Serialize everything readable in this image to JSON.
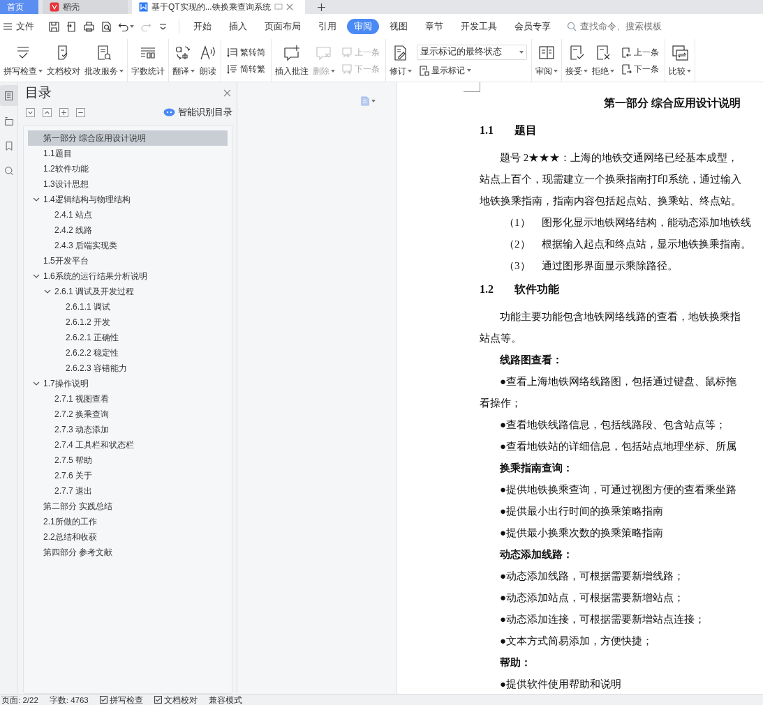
{
  "tabs": [
    {
      "label": "首页",
      "kind": "home",
      "selected": false
    },
    {
      "label": "稻壳",
      "kind": "app",
      "selected": false
    },
    {
      "label": "基于QT实现的...铁换乘查询系统",
      "kind": "doc",
      "selected": true
    }
  ],
  "menu": {
    "file": "文件",
    "quick_access": [
      {
        "disabled": false
      },
      {
        "disabled": false
      },
      {
        "disabled": false
      },
      {
        "disabled": false
      },
      {
        "disabled": false
      },
      {
        "disabled": true
      },
      {
        "disabled": false
      }
    ],
    "tabs": [
      {
        "label": "开始",
        "selected": false
      },
      {
        "label": "插入",
        "selected": false
      },
      {
        "label": "页面布局",
        "selected": false
      },
      {
        "label": "引用",
        "selected": false
      },
      {
        "label": "审阅",
        "selected": true
      },
      {
        "label": "视图",
        "selected": false
      },
      {
        "label": "章节",
        "selected": false
      },
      {
        "label": "开发工具",
        "selected": false
      },
      {
        "label": "会员专享",
        "selected": false
      }
    ],
    "search": {
      "placeholder": "查找命令、搜索模板"
    }
  },
  "ribbon": {
    "groups": [
      [
        {
          "kind": "large",
          "label": "拼写检查",
          "dropdown": true,
          "disabled": false
        },
        {
          "kind": "large",
          "label": "文档校对",
          "dropdown": false,
          "disabled": false
        },
        {
          "kind": "large",
          "label": "批改服务",
          "dropdown": true,
          "disabled": false
        }
      ],
      [
        {
          "kind": "large",
          "label": "字数统计",
          "dropdown": false,
          "disabled": false
        }
      ],
      [
        {
          "kind": "large",
          "label": "翻译",
          "dropdown": true,
          "disabled": false
        },
        {
          "kind": "large",
          "label": "朗读",
          "dropdown": false,
          "disabled": false
        }
      ],
      [
        {
          "kind": "stack",
          "items": [
            {
              "label": "繁转简",
              "disabled": false
            },
            {
              "label": "简转繁",
              "disabled": false
            }
          ]
        }
      ],
      [
        {
          "kind": "large",
          "label": "插入批注",
          "dropdown": false,
          "disabled": false
        },
        {
          "kind": "large",
          "label": "删除",
          "dropdown": true,
          "disabled": true
        },
        {
          "kind": "stack",
          "items": [
            {
              "label": "上一条",
              "disabled": true
            },
            {
              "label": "下一条",
              "disabled": true
            }
          ]
        }
      ],
      [
        {
          "kind": "large",
          "label": "修订",
          "dropdown": true,
          "disabled": false
        },
        {
          "kind": "select",
          "value": "显示标记的最终状态",
          "sub": {
            "label": "显示标记",
            "dropdown": true
          }
        }
      ],
      [
        {
          "kind": "large",
          "label": "审阅",
          "dropdown": true,
          "disabled": false
        }
      ],
      [
        {
          "kind": "large",
          "label": "接受",
          "dropdown": true,
          "disabled": false
        },
        {
          "kind": "large",
          "label": "拒绝",
          "dropdown": true,
          "disabled": false
        },
        {
          "kind": "stack",
          "items": [
            {
              "label": "上一条",
              "disabled": false
            },
            {
              "label": "下一条",
              "disabled": false
            }
          ]
        }
      ],
      [
        {
          "kind": "large",
          "label": "比较",
          "dropdown": true,
          "disabled": false
        }
      ]
    ]
  },
  "side_strip": [
    {
      "selected": true
    },
    {
      "selected": false
    },
    {
      "selected": false
    },
    {
      "selected": false
    }
  ],
  "nav": {
    "title": "目录",
    "smart_button": "智能识别目录",
    "toc": [
      {
        "label": "第一部分  综合应用设计说明",
        "selected": true
      },
      {
        "label": "1.1题目",
        "selected": false
      },
      {
        "label": "1.2软件功能",
        "selected": false
      },
      {
        "label": "1.3设计思想",
        "selected": false
      },
      {
        "label": "1.4逻辑结构与物理结构",
        "selected": false,
        "expanded": true,
        "children": [
          {
            "label": "2.4.1  站点",
            "selected": false
          },
          {
            "label": "2.4.2  线路",
            "selected": false
          },
          {
            "label": "2.4.3  后端实现类",
            "selected": false
          }
        ]
      },
      {
        "label": "1.5开发平台",
        "selected": false
      },
      {
        "label": "1.6系统的运行结果分析说明",
        "selected": false,
        "expanded": true,
        "children": [
          {
            "label": "2.6.1  调试及开发过程",
            "selected": false,
            "expanded": true,
            "children": [
              {
                "label": "2.6.1.1  调试",
                "selected": false
              },
              {
                "label": "2.6.1.2  开发",
                "selected": false
              },
              {
                "label": "2.6.2.1  正确性",
                "selected": false
              },
              {
                "label": "2.6.2.2  稳定性",
                "selected": false
              },
              {
                "label": "2.6.2.3  容错能力",
                "selected": false
              }
            ]
          }
        ]
      },
      {
        "label": "1.7操作说明",
        "selected": false,
        "expanded": true,
        "children": [
          {
            "label": "2.7.1  视图查看",
            "selected": false
          },
          {
            "label": "2.7.2  换乘查询",
            "selected": false
          },
          {
            "label": "2.7.3  动态添加",
            "selected": false
          },
          {
            "label": "2.7.4  工具栏和状态栏",
            "selected": false
          },
          {
            "label": "2.7.5  帮助",
            "selected": false
          },
          {
            "label": "2.7.6  关于",
            "selected": false
          },
          {
            "label": "2.7.7  退出",
            "selected": false
          }
        ]
      },
      {
        "label": "第二部分  实践总结",
        "selected": false
      },
      {
        "label": "2.1所做的工作",
        "selected": false
      },
      {
        "label": "2.2总结和收获",
        "selected": false
      },
      {
        "label": "第四部分  参考文献",
        "selected": false
      }
    ]
  },
  "document": {
    "blocks": [
      {
        "kind": "title",
        "text": "第一部分  综合应用设计说明"
      },
      {
        "kind": "heading",
        "number": "1.1",
        "text": "题目"
      },
      {
        "kind": "para",
        "text": "题号 2★★★：上海的地铁交通网络已经基本成型，"
      },
      {
        "kind": "cont",
        "text": "站点上百个，现需建立一个换乘指南打印系统，通过输入"
      },
      {
        "kind": "cont",
        "text": "地铁换乘指南，指南内容包括起点站、换乘站、终点站。"
      },
      {
        "kind": "item",
        "number": "（1）",
        "text": "图形化显示地铁网络结构，能动态添加地铁线"
      },
      {
        "kind": "item",
        "number": "（2）",
        "text": "根据输入起点和终点站，显示地铁换乘指南。"
      },
      {
        "kind": "item",
        "number": "（3）",
        "text": "通过图形界面显示乘除路径。"
      },
      {
        "kind": "heading",
        "number": "1.2",
        "text": "软件功能"
      },
      {
        "kind": "para",
        "text": "功能主要功能包含地铁网络线路的查看，地铁换乘指"
      },
      {
        "kind": "cont",
        "text": "站点等。"
      },
      {
        "kind": "label",
        "text": "线路图查看："
      },
      {
        "kind": "para",
        "text": "●查看上海地铁网络线路图，包括通过键盘、鼠标拖"
      },
      {
        "kind": "cont",
        "text": "看操作；"
      },
      {
        "kind": "para",
        "text": "●查看地铁线路信息，包括线路段、包含站点等；"
      },
      {
        "kind": "para",
        "text": "●查看地铁站的详细信息，包括站点地理坐标、所属"
      },
      {
        "kind": "label",
        "text": "换乘指南查询："
      },
      {
        "kind": "para",
        "text": "●提供地铁换乘查询，可通过视图方便的查看乘坐路"
      },
      {
        "kind": "para",
        "text": "●提供最小出行时间的换乘策略指南"
      },
      {
        "kind": "para",
        "text": "●提供最小换乘次数的换乘策略指南"
      },
      {
        "kind": "label",
        "text": "动态添加线路："
      },
      {
        "kind": "para",
        "text": "●动态添加线路，可根据需要新增线路；"
      },
      {
        "kind": "para",
        "text": "●动态添加站点，可根据需要新增站点；"
      },
      {
        "kind": "para",
        "text": "●动态添加连接，可根据需要新增站点连接；"
      },
      {
        "kind": "para",
        "text": "●文本方式简易添加，方便快捷；"
      },
      {
        "kind": "label",
        "text": "帮助："
      },
      {
        "kind": "para",
        "text": "●提供软件使用帮助和说明"
      }
    ]
  },
  "status_bar": [
    {
      "kind": "text",
      "text": "页面: 2/22"
    },
    {
      "kind": "text",
      "text": "字数: 4763"
    },
    {
      "kind": "check",
      "text": "拼写检查",
      "checked": true
    },
    {
      "kind": "check",
      "text": "文档校对",
      "checked": true
    },
    {
      "kind": "text",
      "text": "兼容模式"
    }
  ]
}
